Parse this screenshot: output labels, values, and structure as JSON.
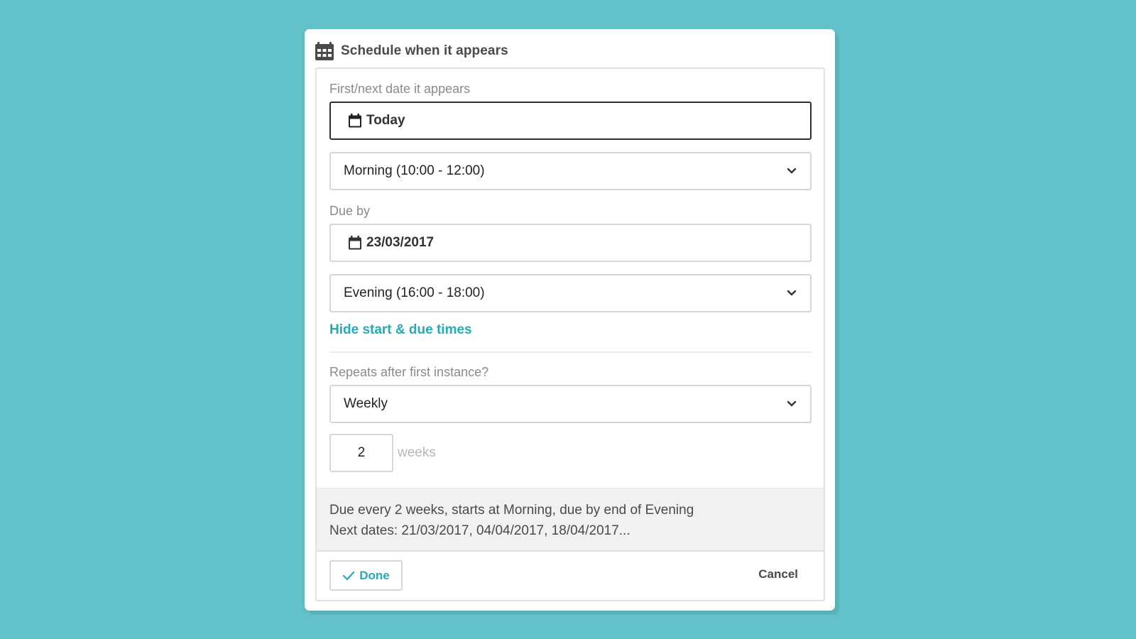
{
  "dialog": {
    "title": "Schedule when it appears",
    "title_icon": "calendar-grid-icon"
  },
  "first_date": {
    "label": "First/next date it appears",
    "value": "Today",
    "icon": "calendar-icon"
  },
  "start_time": {
    "selected": "Morning (10:00 - 12:00)",
    "icon": "chevron-down-icon"
  },
  "due_date": {
    "label": "Due by",
    "value": "23/03/2017",
    "icon": "calendar-icon"
  },
  "due_time": {
    "selected": "Evening (16:00 - 18:00)",
    "icon": "chevron-down-icon"
  },
  "toggle_link": "Hide start & due times",
  "repeat": {
    "label": "Repeats after first instance?",
    "selected": "Weekly",
    "interval_value": "2",
    "interval_unit": "weeks"
  },
  "summary": {
    "line1": "Due every 2 weeks, starts at Morning, due by end of Evening",
    "line2": "Next dates: 21/03/2017, 04/04/2017, 18/04/2017..."
  },
  "footer": {
    "done_label": "Done",
    "cancel_label": "Cancel"
  },
  "colors": {
    "background": "#63c2c9",
    "accent": "#27aab3",
    "text": "#4a4a4a"
  }
}
